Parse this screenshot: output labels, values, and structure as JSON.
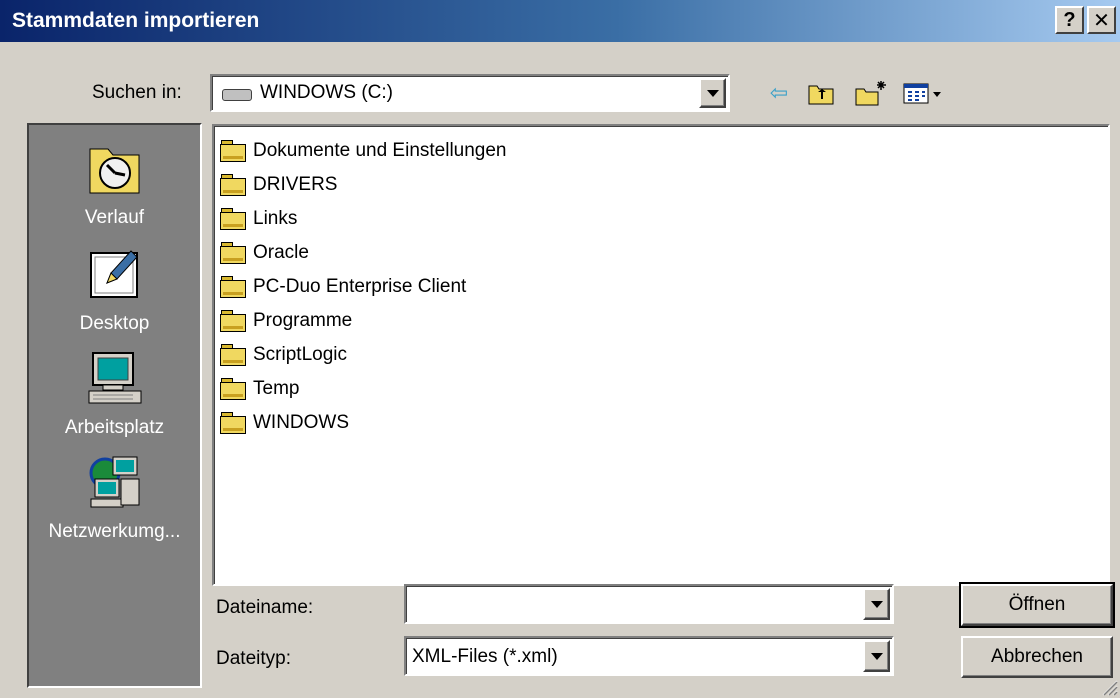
{
  "window": {
    "title": "Stammdaten importieren",
    "help_button": "?",
    "close_button": "✕"
  },
  "lookin": {
    "label": "Suchen in:",
    "value": "WINDOWS (C:)"
  },
  "places": [
    {
      "label": "Verlauf",
      "icon": "history-icon"
    },
    {
      "label": "Desktop",
      "icon": "desktop-icon"
    },
    {
      "label": "Arbeitsplatz",
      "icon": "my-computer-icon"
    },
    {
      "label": "Netzwerkumg...",
      "icon": "network-icon"
    }
  ],
  "files": [
    "Dokumente und Einstellungen",
    "DRIVERS",
    "Links",
    "Oracle",
    "PC-Duo Enterprise Client",
    "Programme",
    "ScriptLogic",
    "Temp",
    "WINDOWS"
  ],
  "filename": {
    "label": "Dateiname:",
    "value": ""
  },
  "filetype": {
    "label": "Dateityp:",
    "value": "XML-Files (*.xml)"
  },
  "buttons": {
    "open": "Öffnen",
    "cancel": "Abbrechen"
  },
  "colors": {
    "title_start": "#0a246a",
    "title_end": "#a6caf0",
    "face": "#d4d0c8",
    "places_bg": "#808080"
  }
}
